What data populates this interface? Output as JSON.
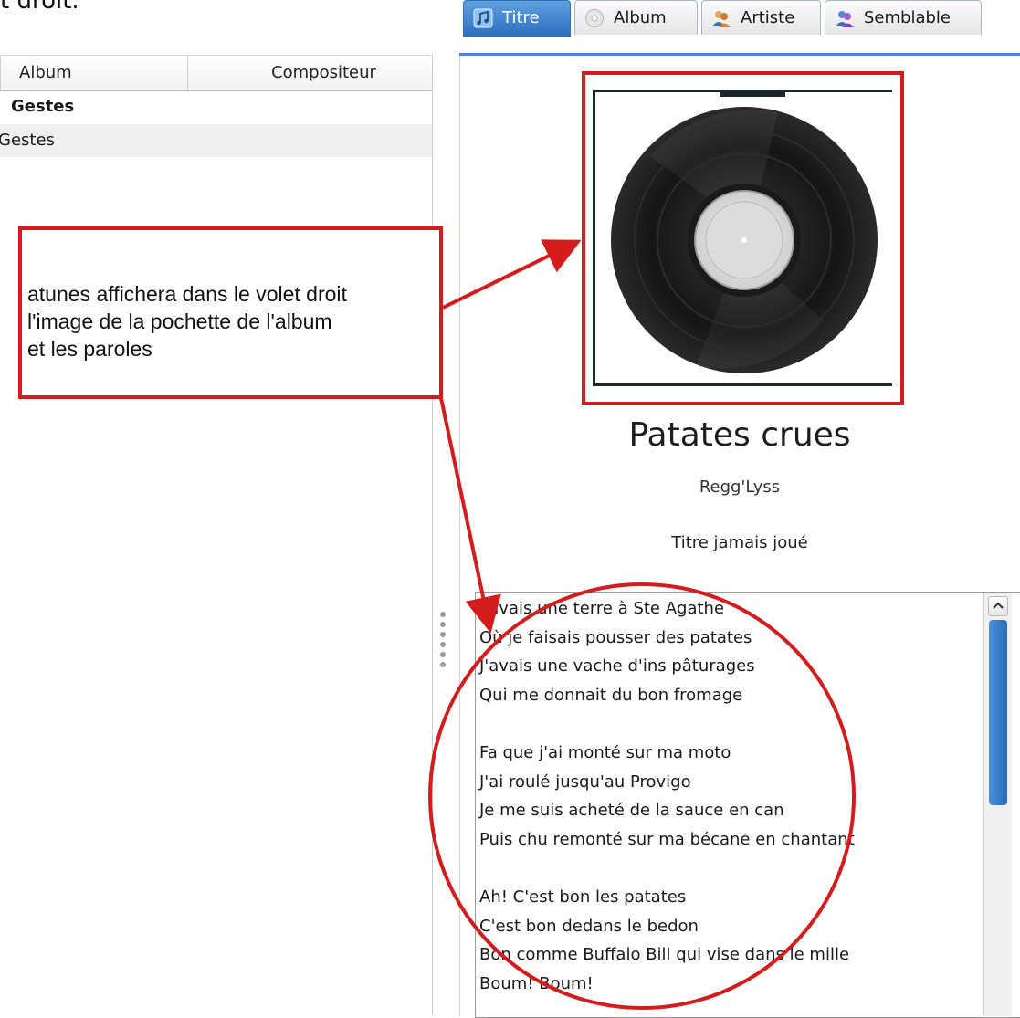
{
  "page_fragment": "t droit.",
  "left_pane": {
    "columns": [
      "Album",
      "Compositeur"
    ],
    "rows": [
      {
        "album": "Gestes"
      },
      {
        "album": "Gestes"
      }
    ]
  },
  "tabs": [
    {
      "label": "Titre",
      "icon": "music-note-icon",
      "active": true
    },
    {
      "label": "Album",
      "icon": "disc-icon",
      "active": false
    },
    {
      "label": "Artiste",
      "icon": "artist-icon",
      "active": false
    },
    {
      "label": "Semblable",
      "icon": "similar-users-icon",
      "active": false
    }
  ],
  "now_playing": {
    "title": "Patates crues",
    "artist": "Regg'Lyss",
    "status": "Titre jamais joué",
    "lyrics": "J'avais une terre à Ste Agathe\nOù je faisais pousser des patates\nJ'avais une vache d'ins pâturages\nQui me donnait du bon fromage\n\nFa que j'ai monté sur ma moto\nJ'ai roulé jusqu'au Provigo\nJe me suis acheté de la sauce en can\nPuis chu remonté sur ma bécane en chantant\n\nAh! C'est bon les patates\nC'est bon dedans le bedon\nBon comme Buffalo Bill qui vise dans le mille\nBoum! Boum!"
  },
  "annotation": {
    "callout_text": "atunes affichera dans le volet droit\nl'image de la pochette de l'album\net les paroles",
    "accent_color": "#d51c1c"
  }
}
